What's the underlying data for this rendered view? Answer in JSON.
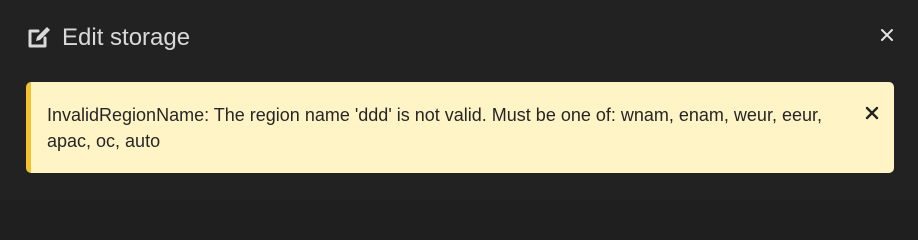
{
  "dialog": {
    "title": "Edit storage",
    "title_icon": "edit-icon",
    "close_icon": "close-icon"
  },
  "alert": {
    "message": "InvalidRegionName: The region name 'ddd' is not valid. Must be one of: wnam, enam, weur, eeur, apac, oc, auto",
    "dismiss_icon": "close-icon",
    "accent_color": "#f2c230",
    "background_color": "#fff4c5"
  },
  "colors": {
    "dialog_background": "#222222",
    "title_text": "#d9d9d9"
  }
}
